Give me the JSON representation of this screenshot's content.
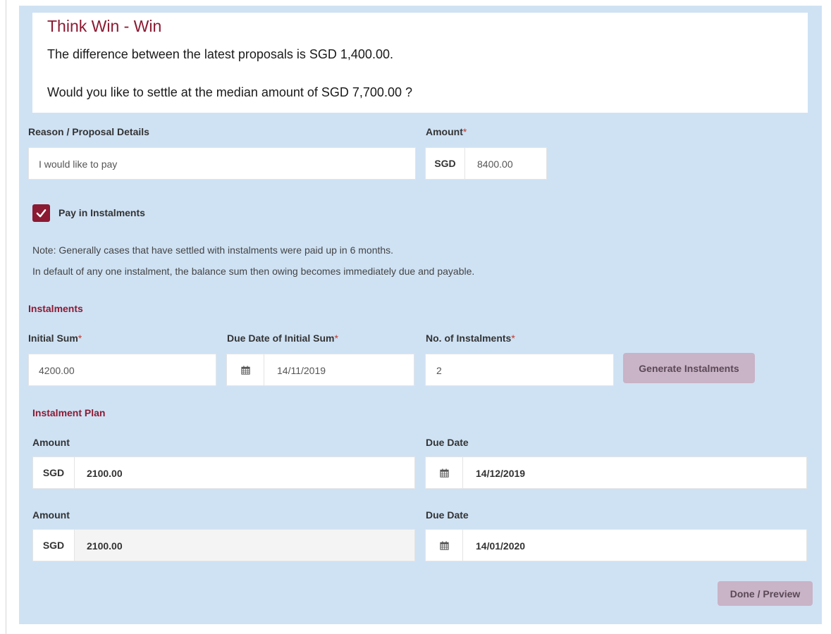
{
  "banner": {
    "title": "Think Win - Win",
    "line1": "The difference between the latest proposals is SGD 1,400.00.",
    "line2": "Would you like to settle at the median amount of SGD 7,700.00 ?"
  },
  "proposal": {
    "reason_label": "Reason / Proposal Details",
    "reason_value": "I would like to pay",
    "amount_label": "Amount",
    "required_mark": "*",
    "currency": "SGD",
    "amount_value": "8400.00"
  },
  "instalments_toggle": {
    "label": "Pay in Instalments",
    "checked": true
  },
  "notes": {
    "line1": "Note: Generally cases that have settled with instalments were paid up in 6 months.",
    "line2": "In default of any one instalment, the balance sum then owing becomes immediately due and payable."
  },
  "instalments": {
    "heading": "Instalments",
    "initial_sum_label": "Initial Sum",
    "initial_sum_value": "4200.00",
    "due_date_label": "Due Date of Initial Sum",
    "due_date_value": "14/11/2019",
    "count_label": "No. of Instalments",
    "count_value": "2",
    "generate_button": "Generate Instalments"
  },
  "plan": {
    "heading": "Instalment Plan",
    "rows": [
      {
        "amount_label": "Amount",
        "currency": "SGD",
        "amount": "2100.00",
        "due_label": "Due Date",
        "due": "14/12/2019"
      },
      {
        "amount_label": "Amount",
        "currency": "SGD",
        "amount": "2100.00",
        "due_label": "Due Date",
        "due": "14/01/2020"
      }
    ]
  },
  "actions": {
    "done_button": "Done / Preview"
  },
  "colors": {
    "panel_bg": "#cfe2f4",
    "brand": "#8b1a32",
    "button_bg": "#c9b3c6"
  },
  "icons": {
    "calendar": "calendar-icon",
    "check": "check-icon"
  }
}
